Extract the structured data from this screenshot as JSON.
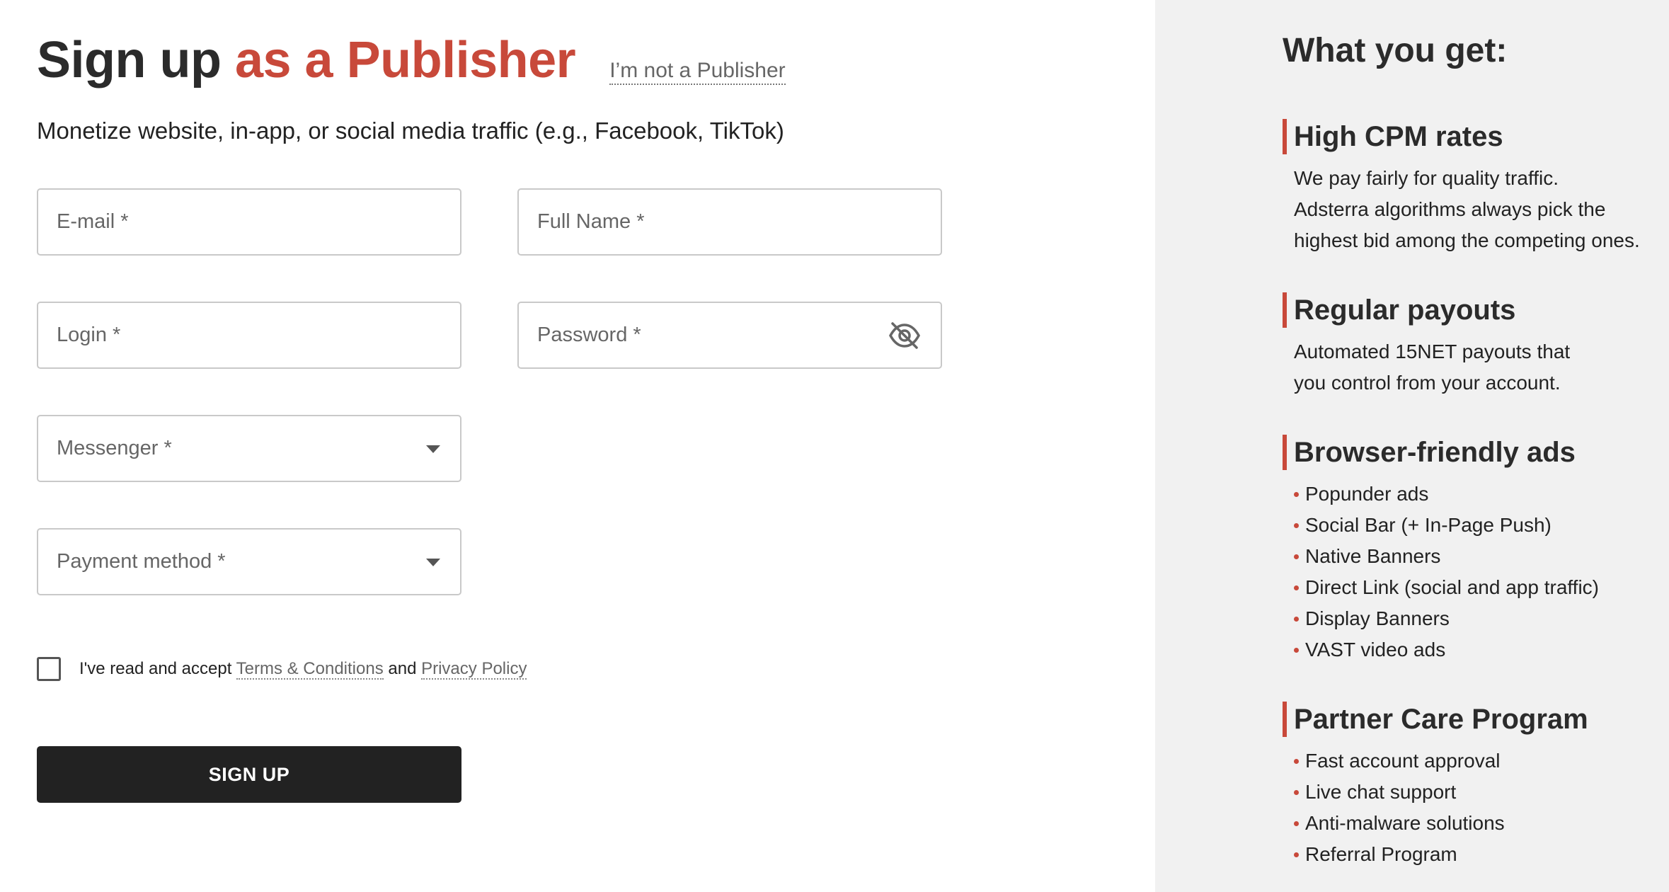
{
  "colors": {
    "accent": "#c8493a",
    "dark": "#222222",
    "panel_bg": "#f1f1f1"
  },
  "header": {
    "title_main": "Sign up ",
    "title_accent": "as a Publisher",
    "not_publisher_link": "I’m not a Publisher",
    "subtitle": "Monetize website, in-app, or social media traffic (e.g., Facebook, TikTok)"
  },
  "form": {
    "email_placeholder": "E-mail *",
    "fullname_placeholder": "Full Name *",
    "login_placeholder": "Login *",
    "password_placeholder": "Password *",
    "password_toggle_icon": "eye-slash-icon",
    "messenger_placeholder": "Messenger *",
    "payment_placeholder": "Payment method *",
    "dropdown_icon": "caret-down-icon",
    "terms_prefix": "I've read and accept ",
    "terms_link": "Terms & Conditions",
    "terms_and": " and ",
    "privacy_link": "Privacy Policy",
    "checkbox_checked": false,
    "signup_label": "SIGN UP"
  },
  "sidebar": {
    "title": "What you get:",
    "features": [
      {
        "heading": "High CPM rates",
        "lines": [
          "We pay fairly for quality traffic.",
          "Adsterra algorithms always pick the",
          "highest bid among the competing ones."
        ]
      },
      {
        "heading": "Regular payouts",
        "lines": [
          "Automated 15NET payouts that",
          "you control from your account."
        ]
      },
      {
        "heading": "Browser-friendly ads",
        "items": [
          "Popunder ads",
          "Social Bar (+ In-Page Push)",
          "Native Banners",
          "Direct Link (social and app traffic)",
          "Display Banners",
          "VAST video ads"
        ]
      },
      {
        "heading": "Partner Care Program",
        "items": [
          "Fast account approval",
          "Live chat support",
          "Anti-malware solutions",
          "Referral Program"
        ]
      }
    ]
  }
}
